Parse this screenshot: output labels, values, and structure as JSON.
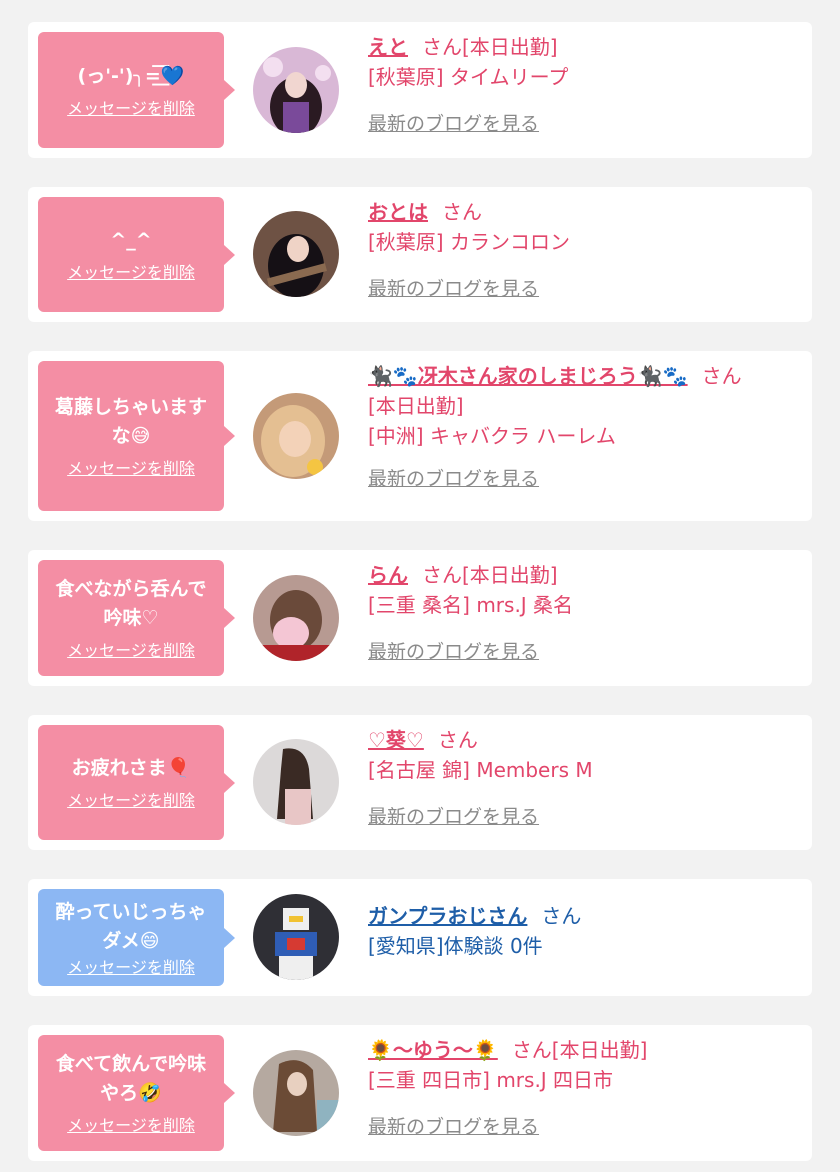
{
  "colors": {
    "pink_bubble": "#f48ea4",
    "blue_bubble": "#8cb7f3",
    "pink_text": "#e2466b",
    "blue_text": "#1e5ea8",
    "gray_link": "#8a8a8a",
    "background": "#f2f2f2"
  },
  "delete_label": "メッセージを削除",
  "blog_label": "最新のブログを見る",
  "entries": [
    {
      "message": "(っ'-')╮=͟͟͞͞💙",
      "name": "えと",
      "suffix": "さん[本日出勤]",
      "line2": "[秋葉原] タイムリープ",
      "line3": ""
    },
    {
      "message": "^_^",
      "name": "おとは",
      "suffix": "さん",
      "line2": "[秋葉原] カランコロン",
      "line3": ""
    },
    {
      "message": "葛藤しちゃいますな😅",
      "name": "🐈‍⬛🐾冴木さん家のしまじろう🐈‍⬛🐾",
      "suffix": "さん",
      "line2": "[本日出勤]",
      "line3": "[中洲] キャバクラ ハーレム"
    },
    {
      "message": "食べながら呑んで吟味♡",
      "name": "らん",
      "suffix": "さん[本日出勤]",
      "line2": "[三重 桑名] mrs.J 桑名",
      "line3": ""
    },
    {
      "message": "お疲れさま🎈",
      "name": "♡葵♡",
      "suffix": "さん",
      "line2": "[名古屋 錦] Members M",
      "line3": ""
    },
    {
      "message": "酔っていじっちゃダメ😄",
      "name": "ガンプラおじさん",
      "suffix": "さん",
      "line2": "[愛知県]体験談 0件",
      "line3": ""
    },
    {
      "message": "食べて飲んで吟味やろ🤣",
      "name": "🌻〜ゆう〜🌻",
      "suffix": "さん[本日出勤]",
      "line2": "[三重 四日市] mrs.J 四日市",
      "line3": ""
    }
  ],
  "avatars": [
    {
      "icon": "user-photo-icon",
      "bg": "#b98ab0",
      "fg": "#2a1a22",
      "face": "#f1d6d0"
    },
    {
      "icon": "user-photo-icon",
      "bg": "#7a5a4a",
      "fg": "#151015",
      "face": "#efd3c6"
    },
    {
      "icon": "user-photo-icon",
      "bg": "#c49a78",
      "fg": "#e9c79a",
      "face": "#f3d2b8"
    },
    {
      "icon": "user-photo-icon",
      "bg": "#c9a5a0",
      "fg": "#6a4a3a",
      "face": "#f4c6d4"
    },
    {
      "icon": "user-photo-icon",
      "bg": "#d9d6d6",
      "fg": "#3a2a24",
      "face": "#e8cfc6"
    },
    {
      "icon": "robot-figure-icon",
      "bg": "#2f2f35",
      "fg": "#2f5db5",
      "face": "#efefef"
    },
    {
      "icon": "user-photo-icon",
      "bg": "#b5a9a0",
      "fg": "#6b4b36",
      "face": "#e8d0c0"
    }
  ]
}
